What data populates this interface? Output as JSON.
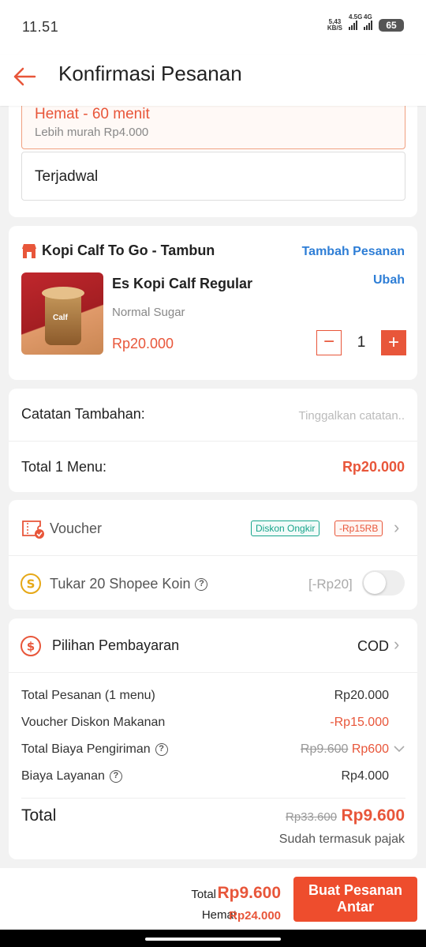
{
  "status_bar": {
    "time": "11.51",
    "net_speed": "5,43",
    "net_unit": "KB/S",
    "sig1_label": "4.5G",
    "sig2_label": "4G",
    "battery": "65"
  },
  "header": {
    "title": "Konfirmasi Pesanan"
  },
  "schedule": {
    "hemat_title": "Hemat - 60 menit",
    "hemat_sub": "Lebih murah Rp4.000",
    "scheduled_label": "Terjadwal"
  },
  "store": {
    "name": "Kopi Calf To Go - Tambun",
    "add_order": "Tambah Pesanan",
    "item": {
      "name": "Es Kopi Calf Regular",
      "edit": "Ubah",
      "note": "Normal Sugar",
      "price": "Rp20.000",
      "qty": "1",
      "cup_logo": "Calf"
    }
  },
  "notes": {
    "label": "Catatan Tambahan:",
    "placeholder": "Tinggalkan catatan..",
    "total_label": "Total 1 Menu:",
    "total_value": "Rp20.000"
  },
  "voucher": {
    "label": "Voucher",
    "tag_ongkir": "Diskon Ongkir",
    "tag_discount": "-Rp15RB"
  },
  "koin": {
    "label": "Tukar 20 Shopee Koin",
    "value": "[-Rp20]",
    "enabled": false
  },
  "payment": {
    "label": "Pilihan Pembayaran",
    "method": "COD",
    "rows": {
      "order_total_label": "Total Pesanan (1 menu)",
      "order_total_value": "Rp20.000",
      "voucher_label": "Voucher Diskon Makanan",
      "voucher_value": "-Rp15.000",
      "shipping_label": "Total Biaya Pengiriman",
      "shipping_old": "Rp9.600",
      "shipping_value": "Rp600",
      "service_label": "Biaya Layanan",
      "service_value": "Rp4.000"
    },
    "total_label": "Total",
    "total_old": "Rp33.600",
    "total_value": "Rp9.600",
    "tax_note": "Sudah termasuk pajak"
  },
  "bottom": {
    "total_label": "Total",
    "total_value": "Rp9.600",
    "hemat_label": "Hemat",
    "hemat_value": "Rp24.000",
    "order_button_line1": "Buat Pesanan",
    "order_button_line2": "Antar"
  },
  "colors": {
    "accent": "#ee4d2d",
    "price": "#e8563a",
    "link": "#2e7ed6",
    "green": "#17a48b"
  }
}
